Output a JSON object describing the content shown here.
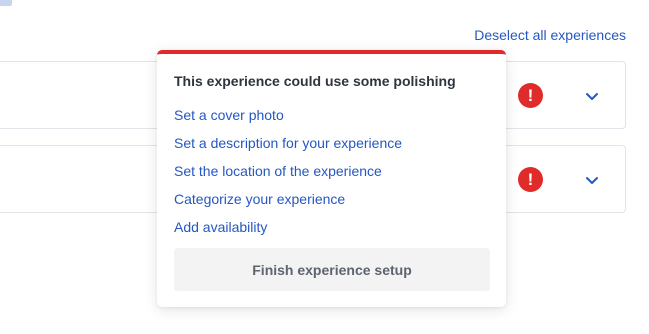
{
  "header": {
    "deselect_label": "Deselect all experiences"
  },
  "rows": [
    {
      "status_icon": "alert-icon",
      "expand_icon": "chevron-down-icon"
    },
    {
      "status_icon": "alert-icon",
      "expand_icon": "chevron-down-icon"
    }
  ],
  "popover": {
    "title": "This experience could use some polishing",
    "tasks": [
      "Set a cover photo",
      "Set a description for your experience",
      "Set the location of the experience",
      "Categorize your experience",
      "Add availability"
    ],
    "button_label": "Finish experience setup"
  },
  "colors": {
    "link": "#2557c2",
    "alert": "#e02b2b",
    "button_bg": "#f3f3f3",
    "border": "#e1e4e9"
  }
}
